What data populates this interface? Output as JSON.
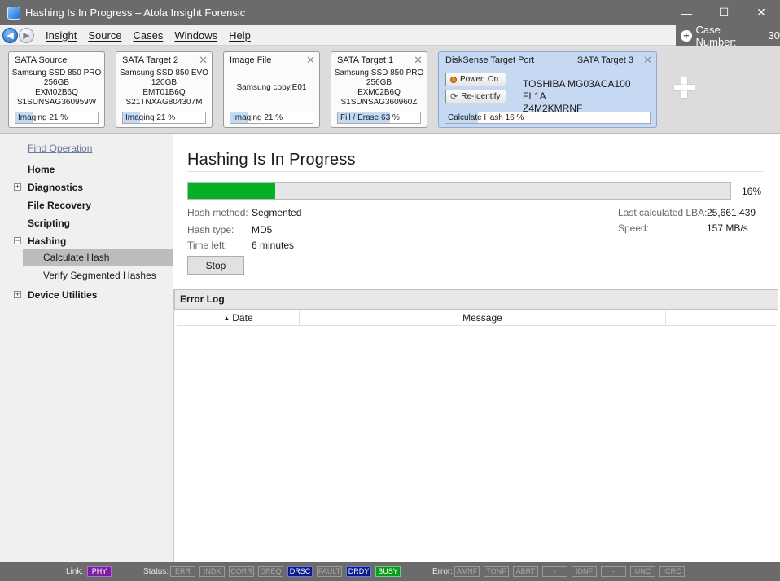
{
  "window": {
    "title": "Hashing Is In Progress – Atola Insight Forensic",
    "minimize": "—",
    "maximize": "☐",
    "close": "✕"
  },
  "menu": {
    "items": [
      "Insight",
      "Source",
      "Cases",
      "Windows",
      "Help"
    ],
    "case_label": "Case Number:",
    "case_number": "30"
  },
  "devices": [
    {
      "header": "SATA Source",
      "closable": false,
      "lines": [
        "Samsung SSD 850 PRO",
        "256GB",
        "EXM02B6Q",
        "S1SUNSAG360959W"
      ],
      "task": "Imaging",
      "progress": "21 %",
      "fraction": 0.21
    },
    {
      "header": "SATA Target 2",
      "closable": true,
      "lines": [
        "Samsung SSD 850 EVO",
        "120GB",
        "EMT01B6Q",
        "S21TNXAG804307M"
      ],
      "task": "Imaging",
      "progress": "21 %",
      "fraction": 0.21
    },
    {
      "header": "Image File",
      "closable": true,
      "lines": [
        "Samsung copy.E01"
      ],
      "task": "Imaging",
      "progress": "21 %",
      "fraction": 0.21
    },
    {
      "header": "SATA Target 1",
      "closable": true,
      "lines": [
        "Samsung SSD 850 PRO",
        "256GB",
        "EXM02B6Q",
        "S1SUNSAG360960Z"
      ],
      "task": "Fill / Erase",
      "progress": "63 %",
      "fraction": 0.63
    }
  ],
  "disksense": {
    "header_left": "DiskSense Target Port",
    "header_right": "SATA Target 3",
    "power_label": "Power: On",
    "reidentify_label": "Re-Identify",
    "model_line1": "TOSHIBA MG03ACA100 FL1A",
    "model_line2": "Z4M2KMRNF",
    "task": "Calculate Hash",
    "progress": "16 %",
    "fraction": 0.16
  },
  "sidebar": {
    "find_operation": "Find Operation",
    "home": "Home",
    "diagnostics": "Diagnostics",
    "file_recovery": "File Recovery",
    "scripting": "Scripting",
    "hashing": "Hashing",
    "calculate_hash": "Calculate Hash",
    "verify_hashes": "Verify Segmented Hashes",
    "device_utilities": "Device Utilities",
    "expand": "+",
    "collapse": "−"
  },
  "main": {
    "title": "Hashing Is In Progress",
    "progress_fraction": 0.16,
    "progress_pct": "16%",
    "hash_method_label": "Hash method:",
    "hash_method": "Segmented",
    "hash_type_label": "Hash type:",
    "hash_type": "MD5",
    "time_left_label": "Time left:",
    "time_left": "6 minutes",
    "last_lba_label": "Last calculated LBA:",
    "last_lba": "25,661,439",
    "speed_label": "Speed:",
    "speed": "157 MB/s",
    "stop_label": "Stop"
  },
  "error_log": {
    "title": "Error Log",
    "col_date": "Date",
    "col_message": "Message"
  },
  "statusbar": {
    "link_label": "Link:",
    "link": "PHY",
    "status_label": "Status:",
    "status_flags": [
      "ERR",
      "INDX",
      "CORR",
      "DREQ",
      "DRSC",
      "FAULT",
      "DRDY",
      "BUSY"
    ],
    "error_label": "Error:",
    "error_flags": [
      "AMNF",
      "TONF",
      "ABRT",
      "-",
      "IDNF",
      "-",
      "UNC",
      "ICRC"
    ]
  },
  "colors": {
    "progress_green": "#06b025",
    "flag_purple": "#7a1fa0",
    "flag_blue": "#0a1a8c",
    "flag_green": "#0c9a1c"
  }
}
